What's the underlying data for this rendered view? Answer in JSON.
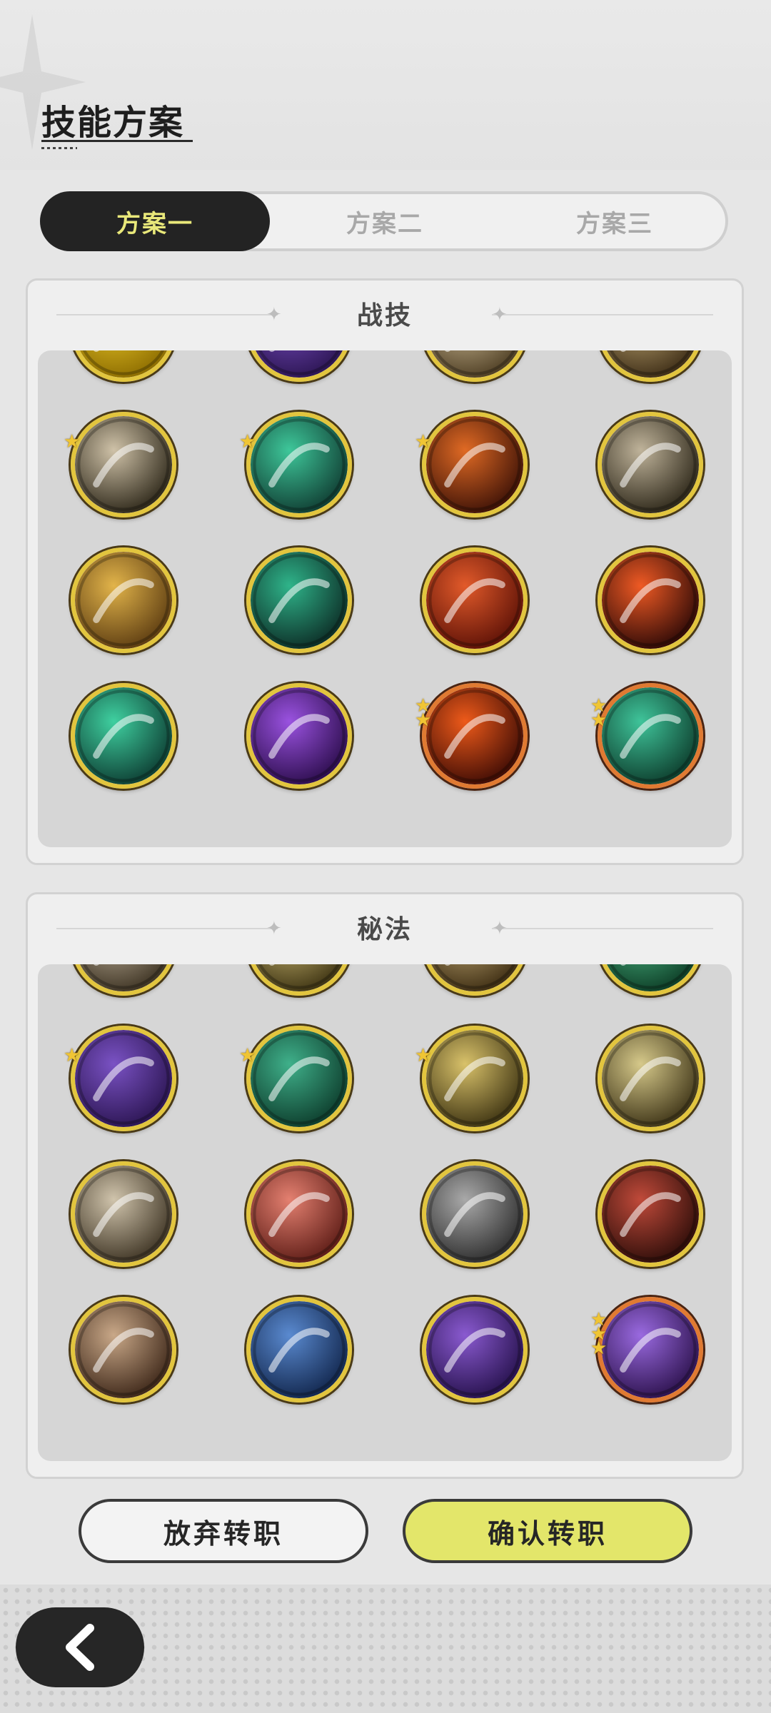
{
  "page": {
    "title": "技能方案"
  },
  "tabs": [
    {
      "label": "方案一",
      "active": true
    },
    {
      "label": "方案二",
      "active": false
    },
    {
      "label": "方案三",
      "active": false
    }
  ],
  "combat_skills": {
    "title": "战技",
    "icons": [
      "golden-shield-icon",
      "purple-claw-icon",
      "light-slash-icon",
      "bone-spear-icon",
      "warrior-strike-icon",
      "emerald-sword-icon",
      "flame-icon",
      "wind-slash-icon",
      "golden-whirl-icon",
      "teal-crescent-icon",
      "fire-emblem-icon",
      "fire-arc-icon",
      "green-rise-icon",
      "purple-ghost-icon",
      "fire-swirl-icon",
      "green-vortex-icon"
    ]
  },
  "secret_arts": {
    "title": "秘法",
    "icons": [
      "sword-rune-icon",
      "dark-figure-icon",
      "compass-icon",
      "heart-plus-icon",
      "beast-icon",
      "heal-circle-icon",
      "meditate-icon",
      "eye-icon",
      "blade-icon",
      "red-sword-icon",
      "shield-warrior-icon",
      "red-armor-icon",
      "heart-shield-icon",
      "blue-crystal-icon",
      "purple-silhouette-icon",
      "purple-orb-icon"
    ]
  },
  "buttons": {
    "abandon": "放弃转职",
    "confirm": "确认转职"
  },
  "colors": {
    "accent_yellow": "#e3e66a",
    "tab_active_bg": "#232323",
    "tab_active_text": "#e9e87a"
  }
}
